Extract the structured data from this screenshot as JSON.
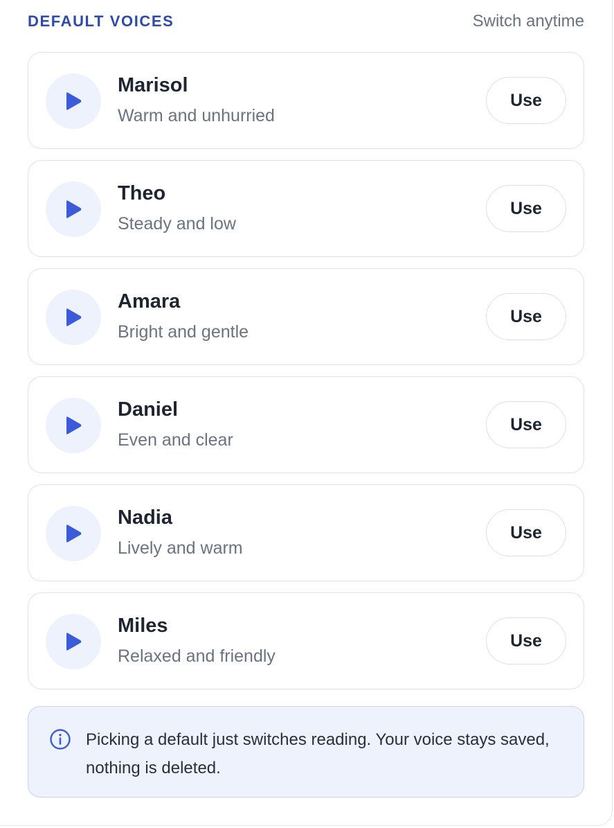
{
  "header": {
    "title": "DEFAULT VOICES",
    "hint": "Switch anytime"
  },
  "voices": [
    {
      "name": "Marisol",
      "description": "Warm and unhurried",
      "action_label": "Use"
    },
    {
      "name": "Theo",
      "description": "Steady and low",
      "action_label": "Use"
    },
    {
      "name": "Amara",
      "description": "Bright and gentle",
      "action_label": "Use"
    },
    {
      "name": "Daniel",
      "description": "Even and clear",
      "action_label": "Use"
    },
    {
      "name": "Nadia",
      "description": "Lively and warm",
      "action_label": "Use"
    },
    {
      "name": "Miles",
      "description": "Relaxed and friendly",
      "action_label": "Use"
    }
  ],
  "info": {
    "text": "Picking a default just switches reading. Your voice stays saved, nothing is deleted."
  },
  "icons": {
    "play": "play-icon",
    "info": "info-icon"
  },
  "colors": {
    "accent": "#3b5bdb",
    "title": "#2d4aa8",
    "info_bg": "#eef2fd",
    "info_border": "#c7d3f3"
  }
}
